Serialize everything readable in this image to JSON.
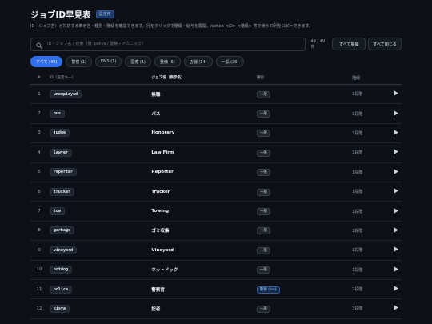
{
  "header": {
    "title": "ジョブID早見表",
    "badge": "設定用",
    "description": "ID（ジョブ名）と対応する表示名・種別・階級を確認できます。行をクリックで階級・給与を展開。/setjob <ID> <階級> 等で使うID列をコピーできます。"
  },
  "search": {
    "placeholder": "ID・ジョブ名で検索（例: police / 警察 / メカニック）",
    "value": "",
    "count": "49 / 49 件",
    "expand_all": "すべて展開",
    "collapse_all": "すべて閉じる"
  },
  "tabs": [
    {
      "label": "すべて (49)",
      "active": true
    },
    {
      "label": "警察 (1)",
      "active": false
    },
    {
      "label": "EMS (1)",
      "active": false
    },
    {
      "label": "医療 (1)",
      "active": false
    },
    {
      "label": "整備 (6)",
      "active": false
    },
    {
      "label": "店舗 (14)",
      "active": false
    },
    {
      "label": "一般 (26)",
      "active": false
    }
  ],
  "table": {
    "headers": {
      "num": "#",
      "key": "ID（設定キー）",
      "name": "ジョブ名（表示名）",
      "type": "種別",
      "grade": "階級"
    },
    "rows": [
      {
        "num": "1",
        "key": "unemployed",
        "name": "無職",
        "type": "一般",
        "grade": "1段階"
      },
      {
        "num": "2",
        "key": "bus",
        "name": "バス",
        "type": "一般",
        "grade": "1段階"
      },
      {
        "num": "3",
        "key": "judge",
        "name": "Honorary",
        "type": "一般",
        "grade": "1段階"
      },
      {
        "num": "4",
        "key": "lawyer",
        "name": "Law Firm",
        "type": "一般",
        "grade": "1段階"
      },
      {
        "num": "5",
        "key": "reporter",
        "name": "Reporter",
        "type": "一般",
        "grade": "1段階"
      },
      {
        "num": "6",
        "key": "trucker",
        "name": "Trucker",
        "type": "一般",
        "grade": "1段階"
      },
      {
        "num": "7",
        "key": "tow",
        "name": "Towing",
        "type": "一般",
        "grade": "1段階"
      },
      {
        "num": "8",
        "key": "garbage",
        "name": "ゴミ収集",
        "type": "一般",
        "grade": "1段階"
      },
      {
        "num": "9",
        "key": "vineyard",
        "name": "Vineyard",
        "type": "一般",
        "grade": "1段階"
      },
      {
        "num": "10",
        "key": "hotdog",
        "name": "ホットドック",
        "type": "一般",
        "grade": "1段階"
      },
      {
        "num": "11",
        "key": "police",
        "name": "警察官",
        "type": "警察 (leo)",
        "grade": "7段階"
      },
      {
        "num": "12",
        "key": "kisya",
        "name": "記者",
        "type": "一般",
        "grade": "3段階"
      }
    ]
  },
  "colors": {
    "accent": "#2f6feb",
    "background": "#0d1117"
  },
  "icons": {
    "search": "search-icon",
    "expand": "play-icon"
  }
}
